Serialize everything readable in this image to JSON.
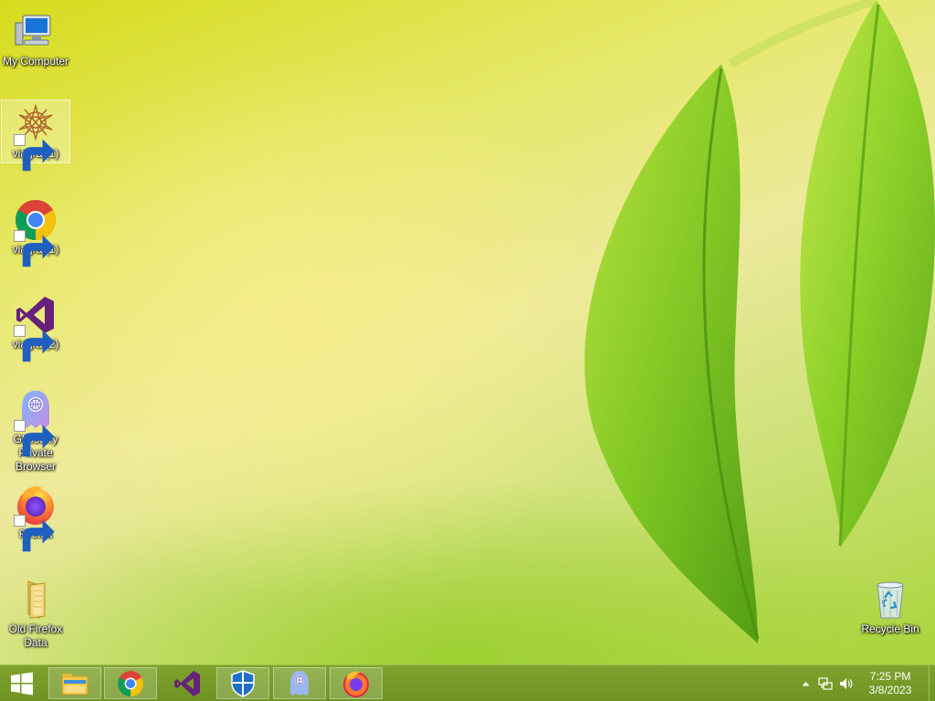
{
  "desktop": {
    "icons": [
      {
        "label": "My Computer",
        "icon": "computer-icon",
        "shortcut": false
      },
      {
        "label": "viagra (1)",
        "icon": "flower-pattern-icon",
        "shortcut": true,
        "selected": true
      },
      {
        "label": "viagra (1)",
        "icon": "chrome-icon",
        "shortcut": true
      },
      {
        "label": "viagra (2)",
        "icon": "visual-studio-icon",
        "shortcut": true
      },
      {
        "label": "Ghostery\nPrivate\nBrowser",
        "icon": "ghostery-icon",
        "shortcut": true
      },
      {
        "label": "Firefox",
        "icon": "firefox-icon",
        "shortcut": true
      },
      {
        "label": "Old Firefox\nData",
        "icon": "folder-icon",
        "shortcut": false
      },
      {
        "label": "Recycle Bin",
        "icon": "recycle-bin-icon",
        "shortcut": false
      }
    ]
  },
  "taskbar": {
    "start": {
      "icon": "windows-start-icon"
    },
    "items": [
      {
        "name": "file-explorer",
        "icon": "file-explorer-icon"
      },
      {
        "name": "chrome",
        "icon": "chrome-icon"
      },
      {
        "name": "visual-studio",
        "icon": "visual-studio-icon"
      },
      {
        "name": "windows-defender",
        "icon": "defender-shield-icon"
      },
      {
        "name": "ghostery",
        "icon": "ghostery-icon"
      },
      {
        "name": "firefox",
        "icon": "firefox-icon"
      }
    ],
    "tray": {
      "icons": [
        "show-hidden-icons-chevron-icon",
        "network-icon",
        "volume-icon"
      ],
      "time": "7:25 PM",
      "date": "3/8/2023"
    }
  },
  "colors": {
    "taskbar": "#7a9e2a",
    "wallpaper_accent": "#dadf3a",
    "leaf": "#7cc61f"
  }
}
